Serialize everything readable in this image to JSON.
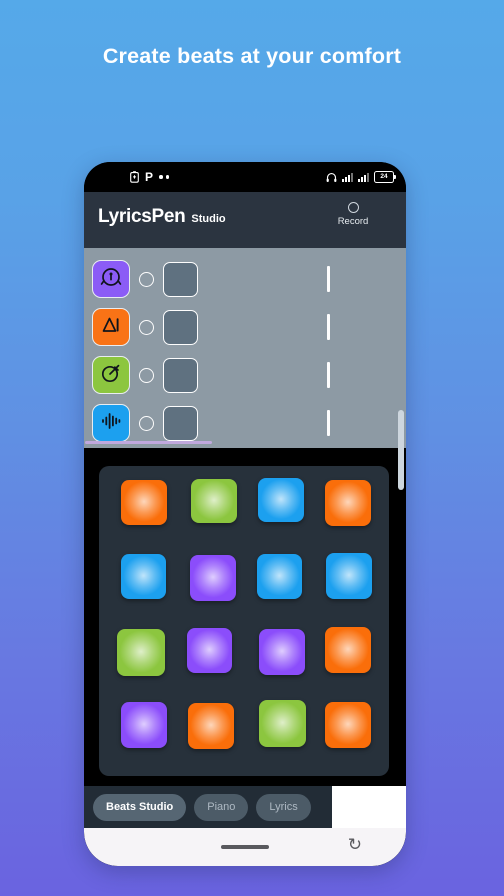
{
  "headline": "Create beats at your comfort",
  "background": {
    "top_color": "#55a9e9",
    "bottom_color": "#6a63e0"
  },
  "phone": {
    "status_bar": {
      "left_icons": [
        "battery-saver-icon",
        "parking-p-icon",
        "more-dots-icon"
      ],
      "right_icons": [
        "headphones-icon",
        "signal-bars-icon",
        "signal-bars-icon"
      ],
      "battery_level": "24"
    },
    "app_header": {
      "brand_primary": "LyricsPen",
      "brand_secondary": "Studio",
      "record_label": "Record",
      "background_color": "#2b3440"
    },
    "tracks": {
      "panel_color": "#8d9aa4",
      "progress_color": "#c0a8dd",
      "rows": [
        {
          "icon": "kick-drum-icon",
          "color": "#8b5cf6",
          "armed": false
        },
        {
          "icon": "triangle-percussion-icon",
          "color": "#f97316",
          "armed": false
        },
        {
          "icon": "hi-hat-cymbal-icon",
          "color": "#8cc63f",
          "armed": false
        },
        {
          "icon": "waveform-icon",
          "color": "#1ca0ef",
          "armed": false
        }
      ]
    },
    "pads": {
      "panel_color": "#27313b",
      "colors": {
        "orange": "#fa6e0a",
        "green": "#8cc63f",
        "blue": "#1ca0ef",
        "purple": "#8b4dfb"
      },
      "grid": [
        [
          "orange",
          "green",
          "blue",
          "orange"
        ],
        [
          "blue",
          "purple",
          "blue",
          "blue"
        ],
        [
          "green",
          "purple",
          "purple",
          "orange"
        ],
        [
          "purple",
          "orange",
          "green",
          "orange"
        ]
      ]
    },
    "tabs": [
      {
        "label": "Beats Studio",
        "active": true
      },
      {
        "label": "Piano",
        "active": false
      },
      {
        "label": "Lyrics",
        "active": false
      }
    ],
    "nav_bar": {
      "icons": [
        "home-gesture-bar",
        "back-icon"
      ]
    }
  }
}
